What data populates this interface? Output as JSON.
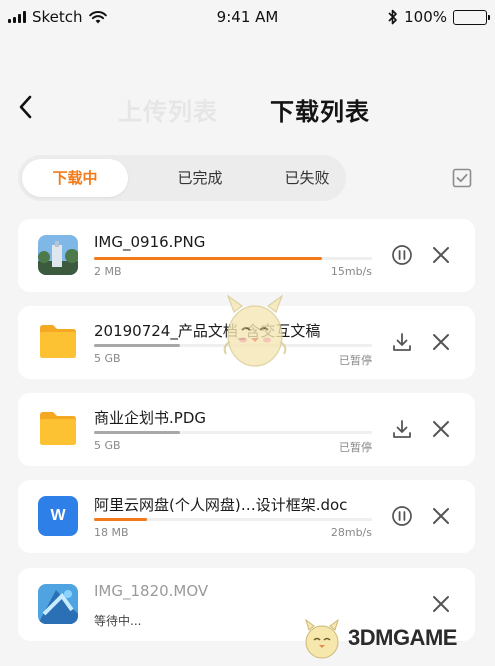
{
  "status_bar": {
    "carrier": "Sketch",
    "time": "9:41 AM",
    "battery": "100%"
  },
  "header": {
    "tab_upload": "上传列表",
    "tab_download": "下载列表"
  },
  "segments": [
    {
      "label": "下载中",
      "active": true
    },
    {
      "label": "已完成",
      "active": false
    },
    {
      "label": "已失败",
      "active": false
    }
  ],
  "files": [
    {
      "name": "IMG_0916.PNG",
      "size": "2 MB",
      "status": "15mb/s",
      "progress": 0.82,
      "action": "pause"
    },
    {
      "name": "20190724_产品文档_含交互文稿",
      "size": "5 GB",
      "status": "已暂停",
      "progress": 0.31,
      "action": "resume"
    },
    {
      "name": "商业企划书.PDG",
      "size": "5 GB",
      "status": "已暂停",
      "progress": 0.31,
      "action": "resume"
    },
    {
      "name": "阿里云网盘(个人网盘)…设计框架.doc",
      "size": "18 MB",
      "status": "28mb/s",
      "progress": 0.19,
      "action": "pause"
    },
    {
      "name": "IMG_1820.MOV",
      "size": "",
      "status": "等待中...",
      "progress": 0,
      "action": "none"
    }
  ],
  "word_icon_letter": "W",
  "watermark": "3DMGAME",
  "colors": {
    "accent": "#f27a1a",
    "folder": "#fbbd21",
    "word": "#2f7fe8",
    "background": "#f5f5f5"
  }
}
